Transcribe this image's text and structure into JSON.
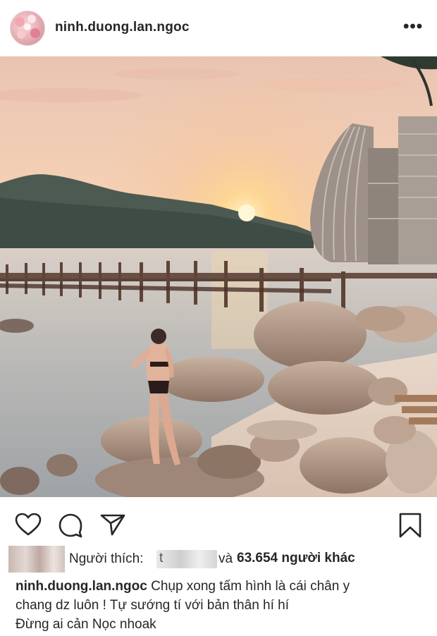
{
  "post": {
    "username": "ninh.duong.lan.ngoc",
    "more_label": "•••"
  },
  "likes": {
    "prefix": "Người thích:",
    "blurred_name_initial": "t",
    "conjunction": "và",
    "count_text": "63.654 người khác"
  },
  "caption": {
    "username": "ninh.duong.lan.ngoc",
    "line1": "Chụp xong tấm hình là cái chân y",
    "line2": "chang dz luôn ! Tự sướng tí với bản thân hí hí",
    "line3": "Đừng ai cản Nọc nhoak"
  },
  "icons": {
    "like": "heart-icon",
    "comment": "comment-icon",
    "share": "send-icon",
    "save": "bookmark-icon"
  },
  "colors": {
    "text": "#262626",
    "sky_top": "#f3c7b0",
    "sky_bottom": "#fbe0bd",
    "sun": "#ffd27a",
    "sea": "#b9bdc0"
  }
}
